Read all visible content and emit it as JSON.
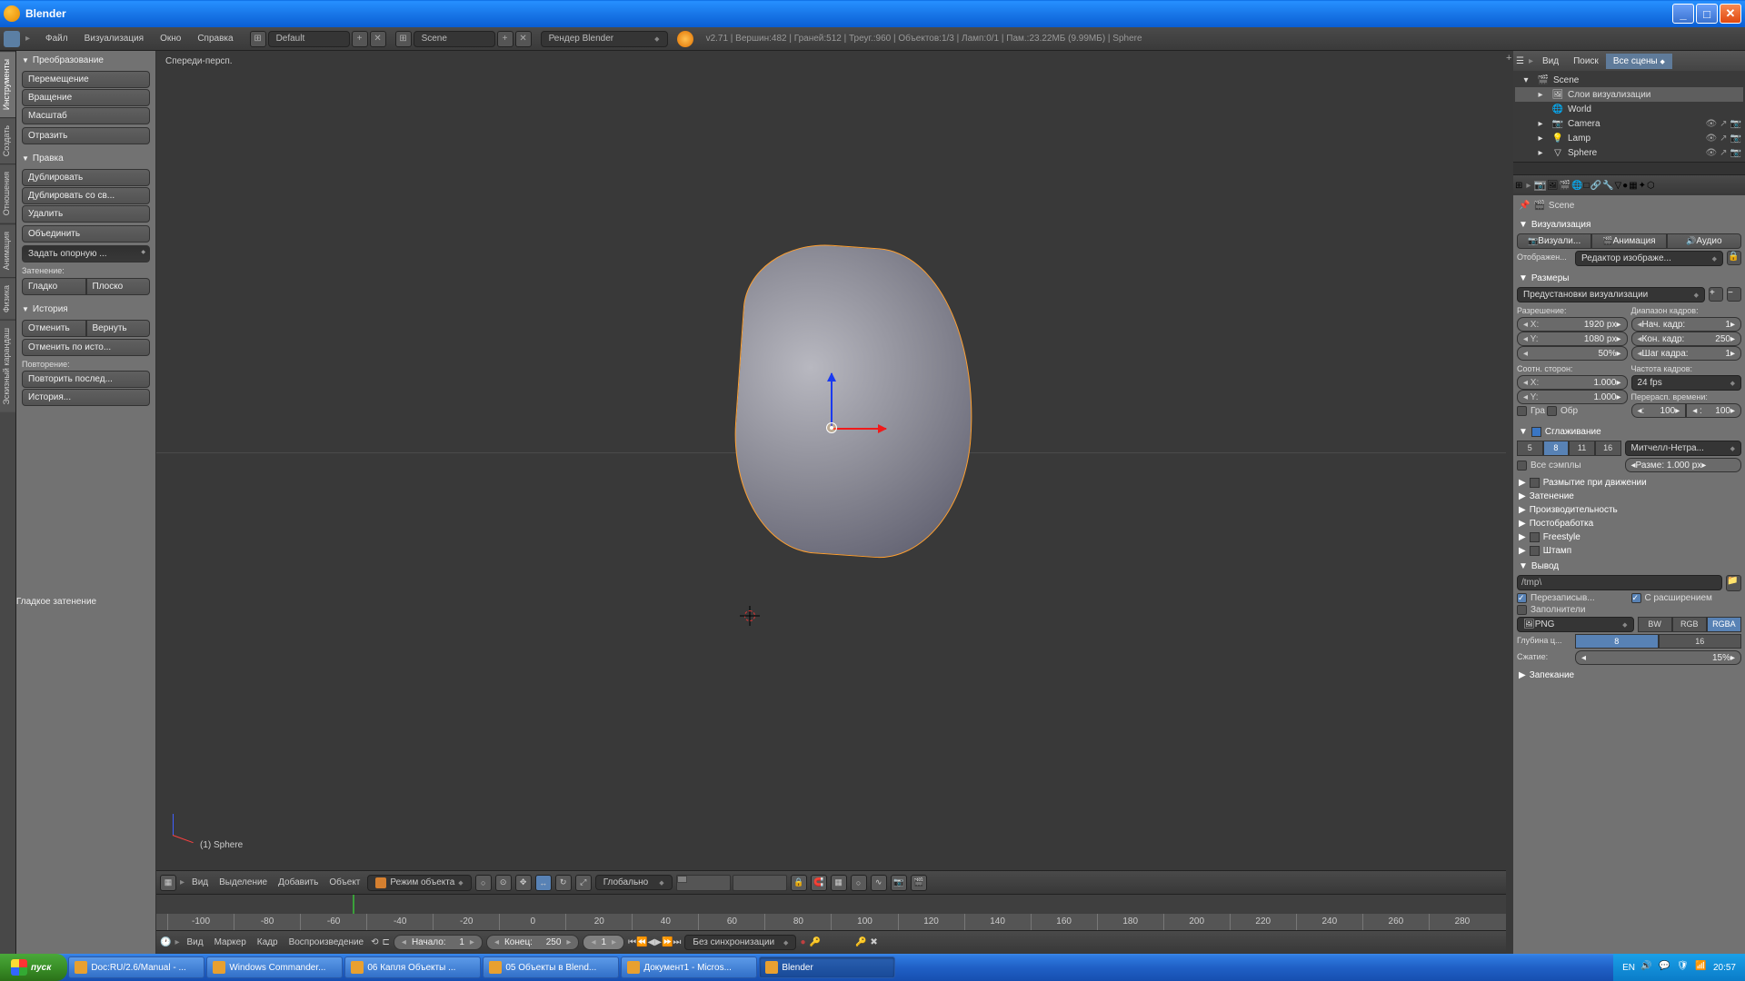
{
  "window": {
    "title": "Blender"
  },
  "menubar": {
    "items": [
      "Файл",
      "Визуализация",
      "Окно",
      "Справка"
    ],
    "layout_preset": "Default",
    "scene": "Scene",
    "engine": "Рендер Blender",
    "stats": "v2.71 | Вершин:482 | Граней:512 | Треуг.:960 | Объектов:1/3 | Ламп:0/1 | Пам.:23.22МБ (9.99МБ) | Sphere"
  },
  "left_tabs": [
    "Инструменты",
    "Создать",
    "Отношения",
    "Анимация",
    "Физика",
    "Эскизный карандаш"
  ],
  "tool_panel": {
    "transform": {
      "title": "Преобразование",
      "translate": "Перемещение",
      "rotate": "Вращение",
      "scale": "Масштаб",
      "mirror": "Отразить"
    },
    "edit": {
      "title": "Правка",
      "duplicate": "Дублировать",
      "duplicate_linked": "Дублировать со св...",
      "delete": "Удалить",
      "join": "Объединить",
      "set_origin": "Задать опорную ...",
      "shading_label": "Затенение:",
      "shade_smooth": "Гладко",
      "shade_flat": "Плоско"
    },
    "history": {
      "title": "История",
      "undo": "Отменить",
      "redo": "Вернуть",
      "undo_history": "Отменить по исто...",
      "repeat_label": "Повторение:",
      "repeat_last": "Повторить послед...",
      "history_btn": "История..."
    },
    "smooth_shading": "Гладкое затенение"
  },
  "viewport": {
    "label_tl": "Спереди-персп.",
    "object_label": "(1) Sphere",
    "header": {
      "menus": [
        "Вид",
        "Выделение",
        "Добавить",
        "Объект"
      ],
      "mode": "Режим объекта",
      "orientation": "Глобально"
    }
  },
  "timeline": {
    "ticks": [
      "-100",
      "-80",
      "-60",
      "-40",
      "-20",
      "0",
      "20",
      "40",
      "60",
      "80",
      "100",
      "120",
      "140",
      "160",
      "180",
      "200",
      "220",
      "240",
      "260",
      "280"
    ],
    "footer": {
      "menus": [
        "Вид",
        "Маркер",
        "Кадр",
        "Воспроизведение"
      ],
      "start_label": "Начало:",
      "start_val": "1",
      "end_label": "Конец:",
      "end_val": "250",
      "current": "1",
      "sync": "Без синхронизации"
    }
  },
  "outliner": {
    "tabs": [
      "Вид",
      "Поиск",
      "Все сцены"
    ],
    "rows": [
      {
        "name": "Scene",
        "icon": "scene",
        "indent": 0,
        "expand": "▾",
        "active": false
      },
      {
        "name": "Слои визуализации",
        "icon": "renderlayers",
        "indent": 1,
        "expand": "▸",
        "active": true
      },
      {
        "name": "World",
        "icon": "world",
        "indent": 1,
        "expand": "",
        "active": false
      },
      {
        "name": "Camera",
        "icon": "camera",
        "indent": 1,
        "expand": "▸",
        "active": false,
        "toggles": true
      },
      {
        "name": "Lamp",
        "icon": "lamp",
        "indent": 1,
        "expand": "▸",
        "active": false,
        "toggles": true
      },
      {
        "name": "Sphere",
        "icon": "mesh",
        "indent": 1,
        "expand": "▸",
        "active": false,
        "toggles": true
      }
    ]
  },
  "props": {
    "breadcrumb": "Scene",
    "render": {
      "title": "Визуализация",
      "render_btn": "Визуали...",
      "anim_btn": "Анимация",
      "audio_btn": "Аудио",
      "display_label": "Отображен...",
      "display_value": "Редактор изображе..."
    },
    "dimensions": {
      "title": "Размеры",
      "preset_label": "Предустановки визуализации",
      "res_label": "Разрешение:",
      "frame_range_label": "Диапазон кадров:",
      "x": "1920 px",
      "y": "1080 px",
      "pct": "50%",
      "start_label": "Нач. кадр:",
      "start": "1",
      "end_label": "Кон. кадр:",
      "end": "250",
      "step_label": "Шаг кадра:",
      "step": "1",
      "aspect_label": "Соотн. сторон:",
      "fps_label": "Частота кадров:",
      "ax": "1.000",
      "ay": "1.000",
      "fps": "24 fps",
      "remap_label": "Перерасп. времени:",
      "border": "Гра",
      "crop": "Обр",
      "old": "100",
      "new": "100"
    },
    "aa": {
      "title": "Сглаживание",
      "samples": [
        "5",
        "8",
        "11",
        "16"
      ],
      "active": "8",
      "filter": "Митчелл-Нетра...",
      "full_sample": "Все сэмплы",
      "size": "Разме: 1.000 px"
    },
    "sections": {
      "motion_blur": "Размытие при движении",
      "shading": "Затенение",
      "performance": "Производительность",
      "post": "Постобработка",
      "freestyle": "Freestyle",
      "stamp": "Штамп"
    },
    "output": {
      "title": "Вывод",
      "path": "/tmp\\",
      "overwrite": "Перезаписыв...",
      "extensions": "С расширением",
      "placeholders": "Заполнители",
      "format": "PNG",
      "modes": [
        "BW",
        "RGB",
        "RGBA"
      ],
      "mode_active": "RGBA",
      "depth_label": "Глубина ц...",
      "depth_options": [
        "8",
        "16"
      ],
      "depth_active": "8",
      "compression_label": "Сжатие:",
      "compression": "15%"
    },
    "bake": "Запекание"
  },
  "taskbar": {
    "start": "пуск",
    "lang": "EN",
    "time": "20:57",
    "items": [
      "Doc:RU/2.6/Manual - ...",
      "Windows Commander...",
      "06 Капля Объекты ...",
      "05 Объекты в Blend...",
      "Документ1 - Micros...",
      "Blender"
    ]
  }
}
